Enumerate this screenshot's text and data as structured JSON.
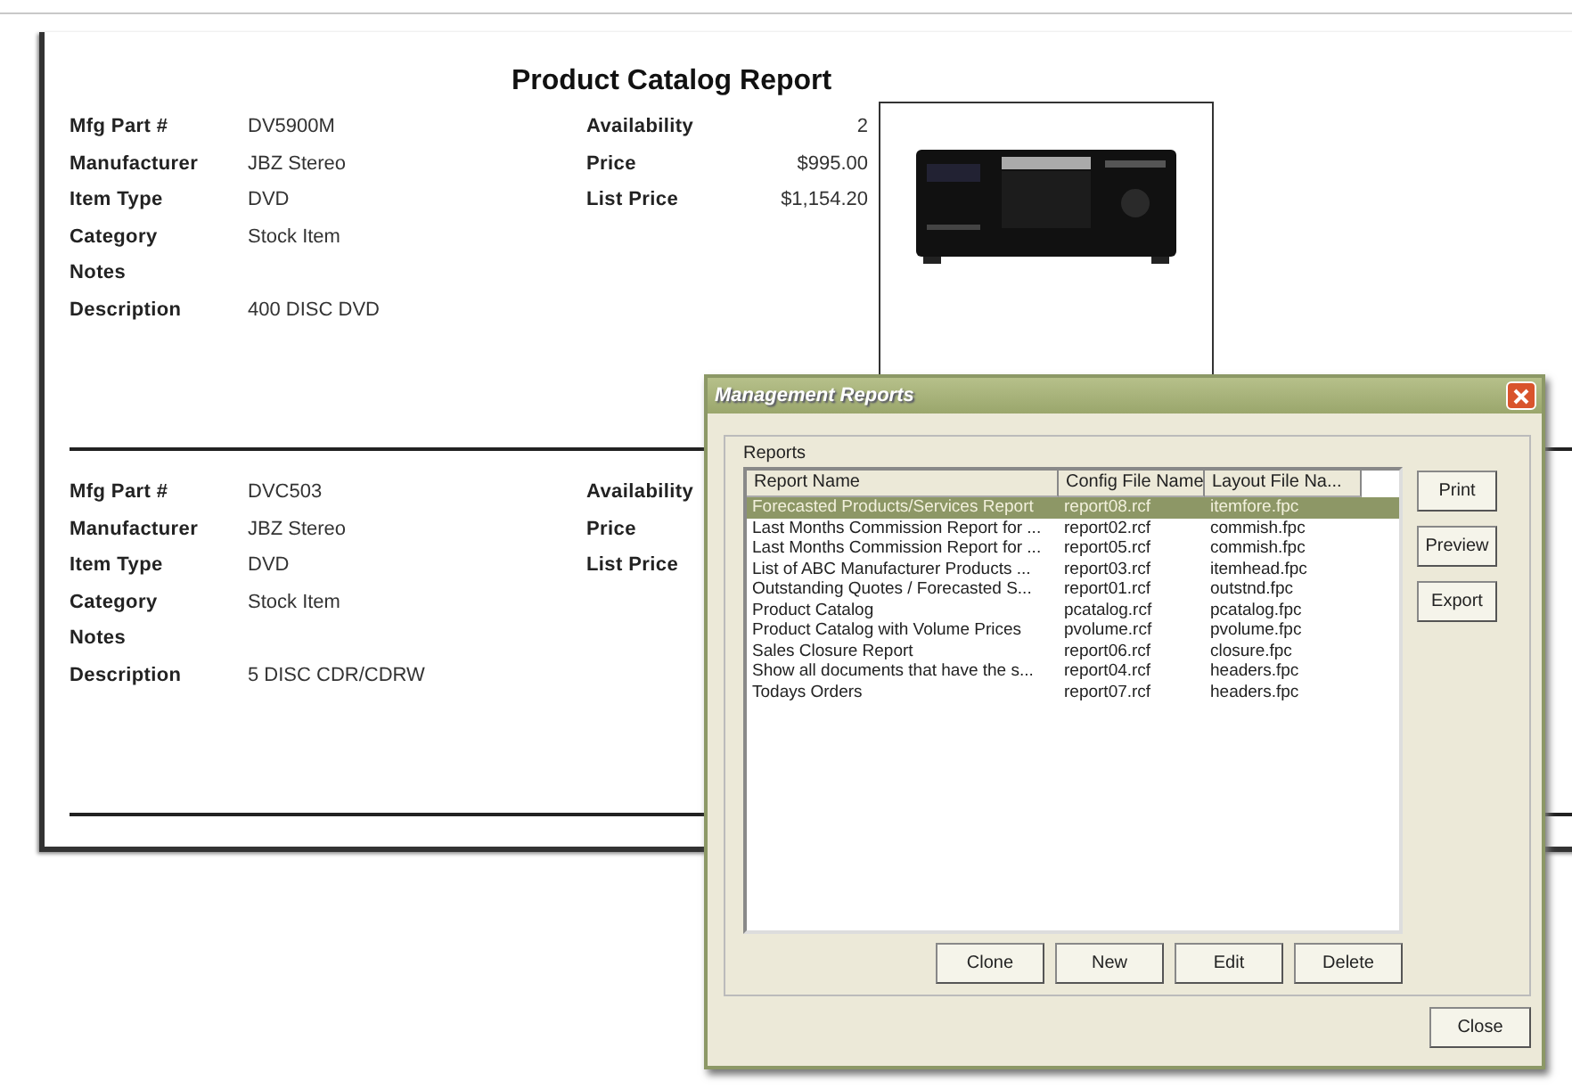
{
  "report": {
    "title": "Product Catalog Report",
    "records": [
      {
        "fields": [
          {
            "label": "Mfg Part #",
            "value": "DV5900M"
          },
          {
            "label": "Manufacturer",
            "value": "JBZ Stereo"
          },
          {
            "label": "Item Type",
            "value": "DVD"
          },
          {
            "label": "Category",
            "value": "Stock Item"
          },
          {
            "label": "Notes"
          },
          {
            "label": "Description",
            "value": "400 DISC DVD"
          }
        ],
        "pricing": [
          {
            "label": "Availability",
            "value": "2"
          },
          {
            "label": "Price",
            "value": "$995.00"
          },
          {
            "label": "List Price",
            "value": "$1,154.20"
          }
        ],
        "image": {
          "kind": "picture"
        }
      },
      {
        "fields": [
          {
            "label": "Mfg Part #",
            "value": "DVC503"
          },
          {
            "label": "Manufacturer",
            "value": "JBZ Stereo"
          },
          {
            "label": "Item Type",
            "value": "DVD"
          },
          {
            "label": "Category",
            "value": "Stock Item"
          },
          {
            "label": "Notes"
          },
          {
            "label": "Description",
            "value": "5 DISC CDR/CDRW"
          }
        ],
        "pricing": [
          {
            "label": "Availability"
          },
          {
            "label": "Price"
          },
          {
            "label": "List Price"
          }
        ]
      }
    ]
  },
  "dialog": {
    "title": "Management Reports",
    "group_label": "Reports",
    "columns": [
      "Report Name",
      "Config File Name",
      "Layout File Na..."
    ],
    "rows": [
      {
        "cells": [
          "Forecasted Products/Services Report",
          "report08.rcf",
          "itemfore.fpc"
        ],
        "selected": true
      },
      {
        "cells": [
          "Last Months Commission Report for ...",
          "report02.rcf",
          "commish.fpc"
        ],
        "selected": false
      },
      {
        "cells": [
          "Last Months Commission Report for ...",
          "report05.rcf",
          "commish.fpc"
        ],
        "selected": false
      },
      {
        "cells": [
          "List of ABC Manufacturer Products ...",
          "report03.rcf",
          "itemhead.fpc"
        ],
        "selected": false
      },
      {
        "cells": [
          "Outstanding Quotes / Forecasted S...",
          "report01.rcf",
          "outstnd.fpc"
        ],
        "selected": false
      },
      {
        "cells": [
          "Product Catalog",
          "pcatalog.rcf",
          "pcatalog.fpc"
        ],
        "selected": false
      },
      {
        "cells": [
          "Product Catalog with Volume Prices",
          "pvolume.rcf",
          "pvolume.fpc"
        ],
        "selected": false
      },
      {
        "cells": [
          "Sales Closure Report",
          "report06.rcf",
          "closure.fpc"
        ],
        "selected": false
      },
      {
        "cells": [
          "Show all documents that have the s...",
          "report04.rcf",
          "headers.fpc"
        ],
        "selected": false
      },
      {
        "cells": [
          "Todays Orders",
          "report07.rcf",
          "headers.fpc"
        ],
        "selected": false
      }
    ],
    "side_buttons": [
      "Print",
      "Preview",
      "Export"
    ],
    "list_buttons": [
      "Clone",
      "New",
      "Edit",
      "Delete"
    ],
    "close_button": "Close"
  }
}
